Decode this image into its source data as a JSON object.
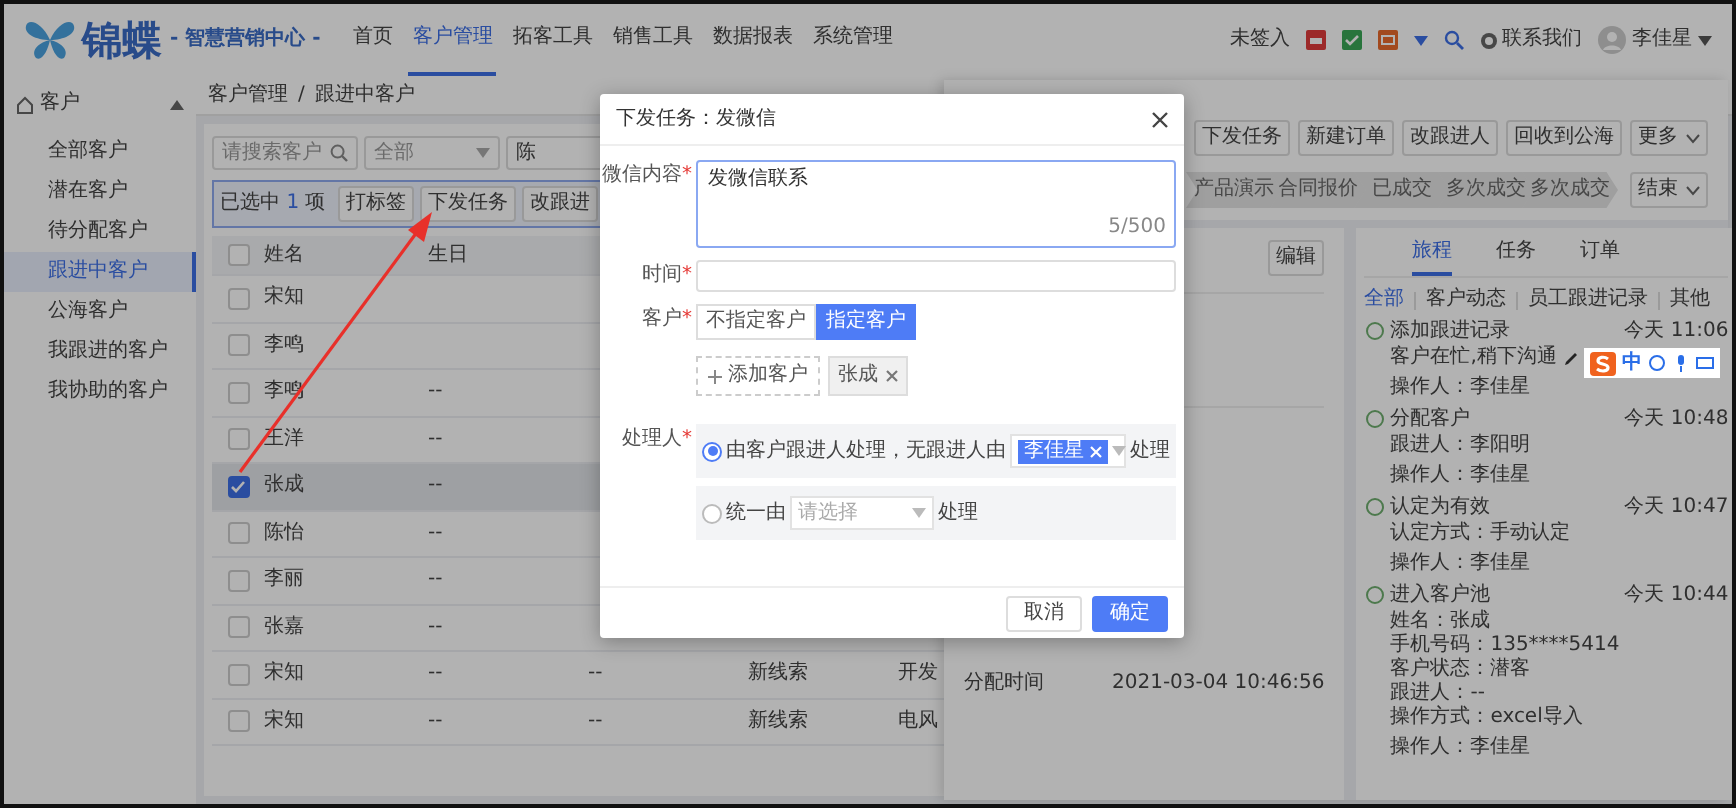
{
  "header": {
    "logo": "锦蝶",
    "tagline": "- 智慧营销中心 -",
    "menu": [
      {
        "label": "首页",
        "selected": false
      },
      {
        "label": "客户管理",
        "selected": true
      },
      {
        "label": "拓客工具",
        "selected": false
      },
      {
        "label": "销售工具",
        "selected": false
      },
      {
        "label": "数据报表",
        "selected": false
      },
      {
        "label": "系统管理",
        "selected": false
      }
    ],
    "checkin": "未签入",
    "contact": "联系我们",
    "user": "李佳星"
  },
  "sidebar": {
    "title": "客户",
    "expanded": true,
    "items": [
      {
        "label": "全部客户",
        "selected": false
      },
      {
        "label": "潜在客户",
        "selected": false
      },
      {
        "label": "待分配客户",
        "selected": false
      },
      {
        "label": "跟进中客户",
        "selected": true
      },
      {
        "label": "公海客户",
        "selected": false
      },
      {
        "label": "我跟进的客户",
        "selected": false
      },
      {
        "label": "我协助的客户",
        "selected": false
      }
    ]
  },
  "breadcrumb": {
    "items": [
      "客户管理",
      "跟进中客户"
    ],
    "separator": "/"
  },
  "filters": {
    "search_placeholder": "请搜索客户",
    "select_1": "全部",
    "select_2": "陈"
  },
  "selection_bar": {
    "prefix": "已选中",
    "count": "1",
    "suffix": "项",
    "actions": [
      "打标签",
      "下发任务",
      "改跟进"
    ]
  },
  "table": {
    "all_checked": false,
    "columns": [
      "姓名",
      "生日"
    ],
    "rows": [
      {
        "checked": false,
        "selected": false,
        "name": "宋知"
      },
      {
        "checked": false,
        "selected": false,
        "name": "李鸣"
      },
      {
        "checked": false,
        "selected": false,
        "name": "李鸣",
        "birthday": "--"
      },
      {
        "checked": false,
        "selected": false,
        "name": "王洋",
        "birthday": "--"
      },
      {
        "checked": true,
        "selected": true,
        "name": "张成",
        "birthday": "--"
      },
      {
        "checked": false,
        "selected": false,
        "name": "陈怡",
        "birthday": "--"
      },
      {
        "checked": false,
        "selected": false,
        "name": "李丽",
        "birthday": "--"
      },
      {
        "checked": false,
        "selected": false,
        "name": "张嘉",
        "birthday": "--"
      },
      {
        "checked": false,
        "selected": false,
        "name": "宋知",
        "birthday": "--",
        "column_3": "--",
        "column_4": "新线索",
        "column_5": "开发"
      },
      {
        "checked": false,
        "selected": false,
        "name": "宋知",
        "birthday": "--",
        "column_3": "--",
        "column_4": "新线索",
        "column_5": "电风"
      }
    ]
  },
  "drawer": {
    "actions": [
      {
        "label": "下发任务",
        "dropdown": false
      },
      {
        "label": "新建订单",
        "dropdown": false
      },
      {
        "label": "改跟进人",
        "dropdown": false
      },
      {
        "label": "回收到公海",
        "dropdown": false
      },
      {
        "label": "更多",
        "dropdown": true
      }
    ],
    "stages": [
      "产品演示",
      "合同报价",
      "已成交",
      "多次成交",
      "多次成交"
    ],
    "stage_menu": "结束",
    "edit": "编辑",
    "fields": [
      {
        "label": "分配时间",
        "value": "2021-03-04 10:46:56"
      }
    ],
    "tabs": [
      {
        "label": "旅程",
        "selected": true
      },
      {
        "label": "任务",
        "selected": false
      },
      {
        "label": "订单",
        "selected": false
      }
    ],
    "filters": [
      {
        "label": "全部",
        "selected": true
      },
      {
        "label": "客户动态",
        "selected": false
      },
      {
        "label": "员工跟进记录",
        "selected": false
      },
      {
        "label": "其他",
        "selected": false
      }
    ],
    "timeline": [
      {
        "title": "添加跟进记录",
        "time": "今天 11:06",
        "lines": [
          {
            "text": "客户在忙,稍下沟通",
            "editable": true
          }
        ],
        "operator": "操作人：李佳星"
      },
      {
        "title": "分配客户",
        "time": "今天 10:48",
        "lines": [
          {
            "text": "跟进人：李阳明",
            "editable": false
          }
        ],
        "operator": "操作人：李佳星"
      },
      {
        "title": "认定为有效",
        "time": "今天 10:47",
        "lines": [
          {
            "text": "认定方式：手动认定",
            "editable": false
          }
        ],
        "operator": "操作人：李佳星"
      },
      {
        "title": "进入客户池",
        "time": "今天 10:44",
        "lines": [
          {
            "text": "姓名：张成",
            "editable": false
          },
          {
            "text": "手机号码：135****5414",
            "editable": false
          },
          {
            "text": "客户状态：潜客",
            "editable": false
          },
          {
            "text": "跟进人：--",
            "editable": false
          },
          {
            "text": "操作方式：excel导入",
            "editable": false
          }
        ],
        "operator": "操作人：李佳星"
      }
    ]
  },
  "ime": {
    "mode": "中"
  },
  "modal": {
    "title": "下发任务：发微信",
    "content": {
      "label": "微信内容",
      "mark": "*",
      "value": "发微信联系",
      "count": "5/500"
    },
    "time": {
      "label": "时间",
      "mark": "*"
    },
    "customer": {
      "label": "客户",
      "mark": "*",
      "options": [
        {
          "label": "不指定客户",
          "selected": false
        },
        {
          "label": "指定客户",
          "selected": true
        }
      ],
      "add": "添加客户",
      "tags": [
        "张成"
      ]
    },
    "handler": {
      "label": "处理人",
      "mark": "*",
      "options": [
        {
          "selected": true,
          "prefix": "由客户跟进人处理，无跟进人由",
          "tags": [
            "李佳星"
          ],
          "suffix": "处理"
        },
        {
          "selected": false,
          "prefix": "统一由",
          "placeholder": "请选择",
          "suffix": "处理"
        }
      ]
    },
    "buttons": [
      {
        "label": "取消",
        "kind": "default"
      },
      {
        "label": "确定",
        "kind": "primary"
      }
    ]
  }
}
